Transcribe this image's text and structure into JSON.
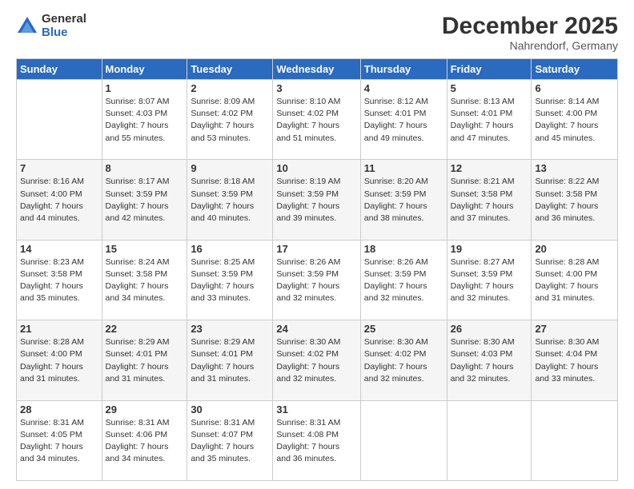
{
  "header": {
    "logo": {
      "general": "General",
      "blue": "Blue"
    },
    "title": "December 2025",
    "location": "Nahrendorf, Germany"
  },
  "calendar": {
    "days_of_week": [
      "Sunday",
      "Monday",
      "Tuesday",
      "Wednesday",
      "Thursday",
      "Friday",
      "Saturday"
    ],
    "weeks": [
      [
        {
          "day": "",
          "info": ""
        },
        {
          "day": "1",
          "info": "Sunrise: 8:07 AM\nSunset: 4:03 PM\nDaylight: 7 hours\nand 55 minutes."
        },
        {
          "day": "2",
          "info": "Sunrise: 8:09 AM\nSunset: 4:02 PM\nDaylight: 7 hours\nand 53 minutes."
        },
        {
          "day": "3",
          "info": "Sunrise: 8:10 AM\nSunset: 4:02 PM\nDaylight: 7 hours\nand 51 minutes."
        },
        {
          "day": "4",
          "info": "Sunrise: 8:12 AM\nSunset: 4:01 PM\nDaylight: 7 hours\nand 49 minutes."
        },
        {
          "day": "5",
          "info": "Sunrise: 8:13 AM\nSunset: 4:01 PM\nDaylight: 7 hours\nand 47 minutes."
        },
        {
          "day": "6",
          "info": "Sunrise: 8:14 AM\nSunset: 4:00 PM\nDaylight: 7 hours\nand 45 minutes."
        }
      ],
      [
        {
          "day": "7",
          "info": "Sunrise: 8:16 AM\nSunset: 4:00 PM\nDaylight: 7 hours\nand 44 minutes."
        },
        {
          "day": "8",
          "info": "Sunrise: 8:17 AM\nSunset: 3:59 PM\nDaylight: 7 hours\nand 42 minutes."
        },
        {
          "day": "9",
          "info": "Sunrise: 8:18 AM\nSunset: 3:59 PM\nDaylight: 7 hours\nand 40 minutes."
        },
        {
          "day": "10",
          "info": "Sunrise: 8:19 AM\nSunset: 3:59 PM\nDaylight: 7 hours\nand 39 minutes."
        },
        {
          "day": "11",
          "info": "Sunrise: 8:20 AM\nSunset: 3:59 PM\nDaylight: 7 hours\nand 38 minutes."
        },
        {
          "day": "12",
          "info": "Sunrise: 8:21 AM\nSunset: 3:58 PM\nDaylight: 7 hours\nand 37 minutes."
        },
        {
          "day": "13",
          "info": "Sunrise: 8:22 AM\nSunset: 3:58 PM\nDaylight: 7 hours\nand 36 minutes."
        }
      ],
      [
        {
          "day": "14",
          "info": "Sunrise: 8:23 AM\nSunset: 3:58 PM\nDaylight: 7 hours\nand 35 minutes."
        },
        {
          "day": "15",
          "info": "Sunrise: 8:24 AM\nSunset: 3:58 PM\nDaylight: 7 hours\nand 34 minutes."
        },
        {
          "day": "16",
          "info": "Sunrise: 8:25 AM\nSunset: 3:59 PM\nDaylight: 7 hours\nand 33 minutes."
        },
        {
          "day": "17",
          "info": "Sunrise: 8:26 AM\nSunset: 3:59 PM\nDaylight: 7 hours\nand 32 minutes."
        },
        {
          "day": "18",
          "info": "Sunrise: 8:26 AM\nSunset: 3:59 PM\nDaylight: 7 hours\nand 32 minutes."
        },
        {
          "day": "19",
          "info": "Sunrise: 8:27 AM\nSunset: 3:59 PM\nDaylight: 7 hours\nand 32 minutes."
        },
        {
          "day": "20",
          "info": "Sunrise: 8:28 AM\nSunset: 4:00 PM\nDaylight: 7 hours\nand 31 minutes."
        }
      ],
      [
        {
          "day": "21",
          "info": "Sunrise: 8:28 AM\nSunset: 4:00 PM\nDaylight: 7 hours\nand 31 minutes."
        },
        {
          "day": "22",
          "info": "Sunrise: 8:29 AM\nSunset: 4:01 PM\nDaylight: 7 hours\nand 31 minutes."
        },
        {
          "day": "23",
          "info": "Sunrise: 8:29 AM\nSunset: 4:01 PM\nDaylight: 7 hours\nand 31 minutes."
        },
        {
          "day": "24",
          "info": "Sunrise: 8:30 AM\nSunset: 4:02 PM\nDaylight: 7 hours\nand 32 minutes."
        },
        {
          "day": "25",
          "info": "Sunrise: 8:30 AM\nSunset: 4:02 PM\nDaylight: 7 hours\nand 32 minutes."
        },
        {
          "day": "26",
          "info": "Sunrise: 8:30 AM\nSunset: 4:03 PM\nDaylight: 7 hours\nand 32 minutes."
        },
        {
          "day": "27",
          "info": "Sunrise: 8:30 AM\nSunset: 4:04 PM\nDaylight: 7 hours\nand 33 minutes."
        }
      ],
      [
        {
          "day": "28",
          "info": "Sunrise: 8:31 AM\nSunset: 4:05 PM\nDaylight: 7 hours\nand 34 minutes."
        },
        {
          "day": "29",
          "info": "Sunrise: 8:31 AM\nSunset: 4:06 PM\nDaylight: 7 hours\nand 34 minutes."
        },
        {
          "day": "30",
          "info": "Sunrise: 8:31 AM\nSunset: 4:07 PM\nDaylight: 7 hours\nand 35 minutes."
        },
        {
          "day": "31",
          "info": "Sunrise: 8:31 AM\nSunset: 4:08 PM\nDaylight: 7 hours\nand 36 minutes."
        },
        {
          "day": "",
          "info": ""
        },
        {
          "day": "",
          "info": ""
        },
        {
          "day": "",
          "info": ""
        }
      ]
    ]
  }
}
